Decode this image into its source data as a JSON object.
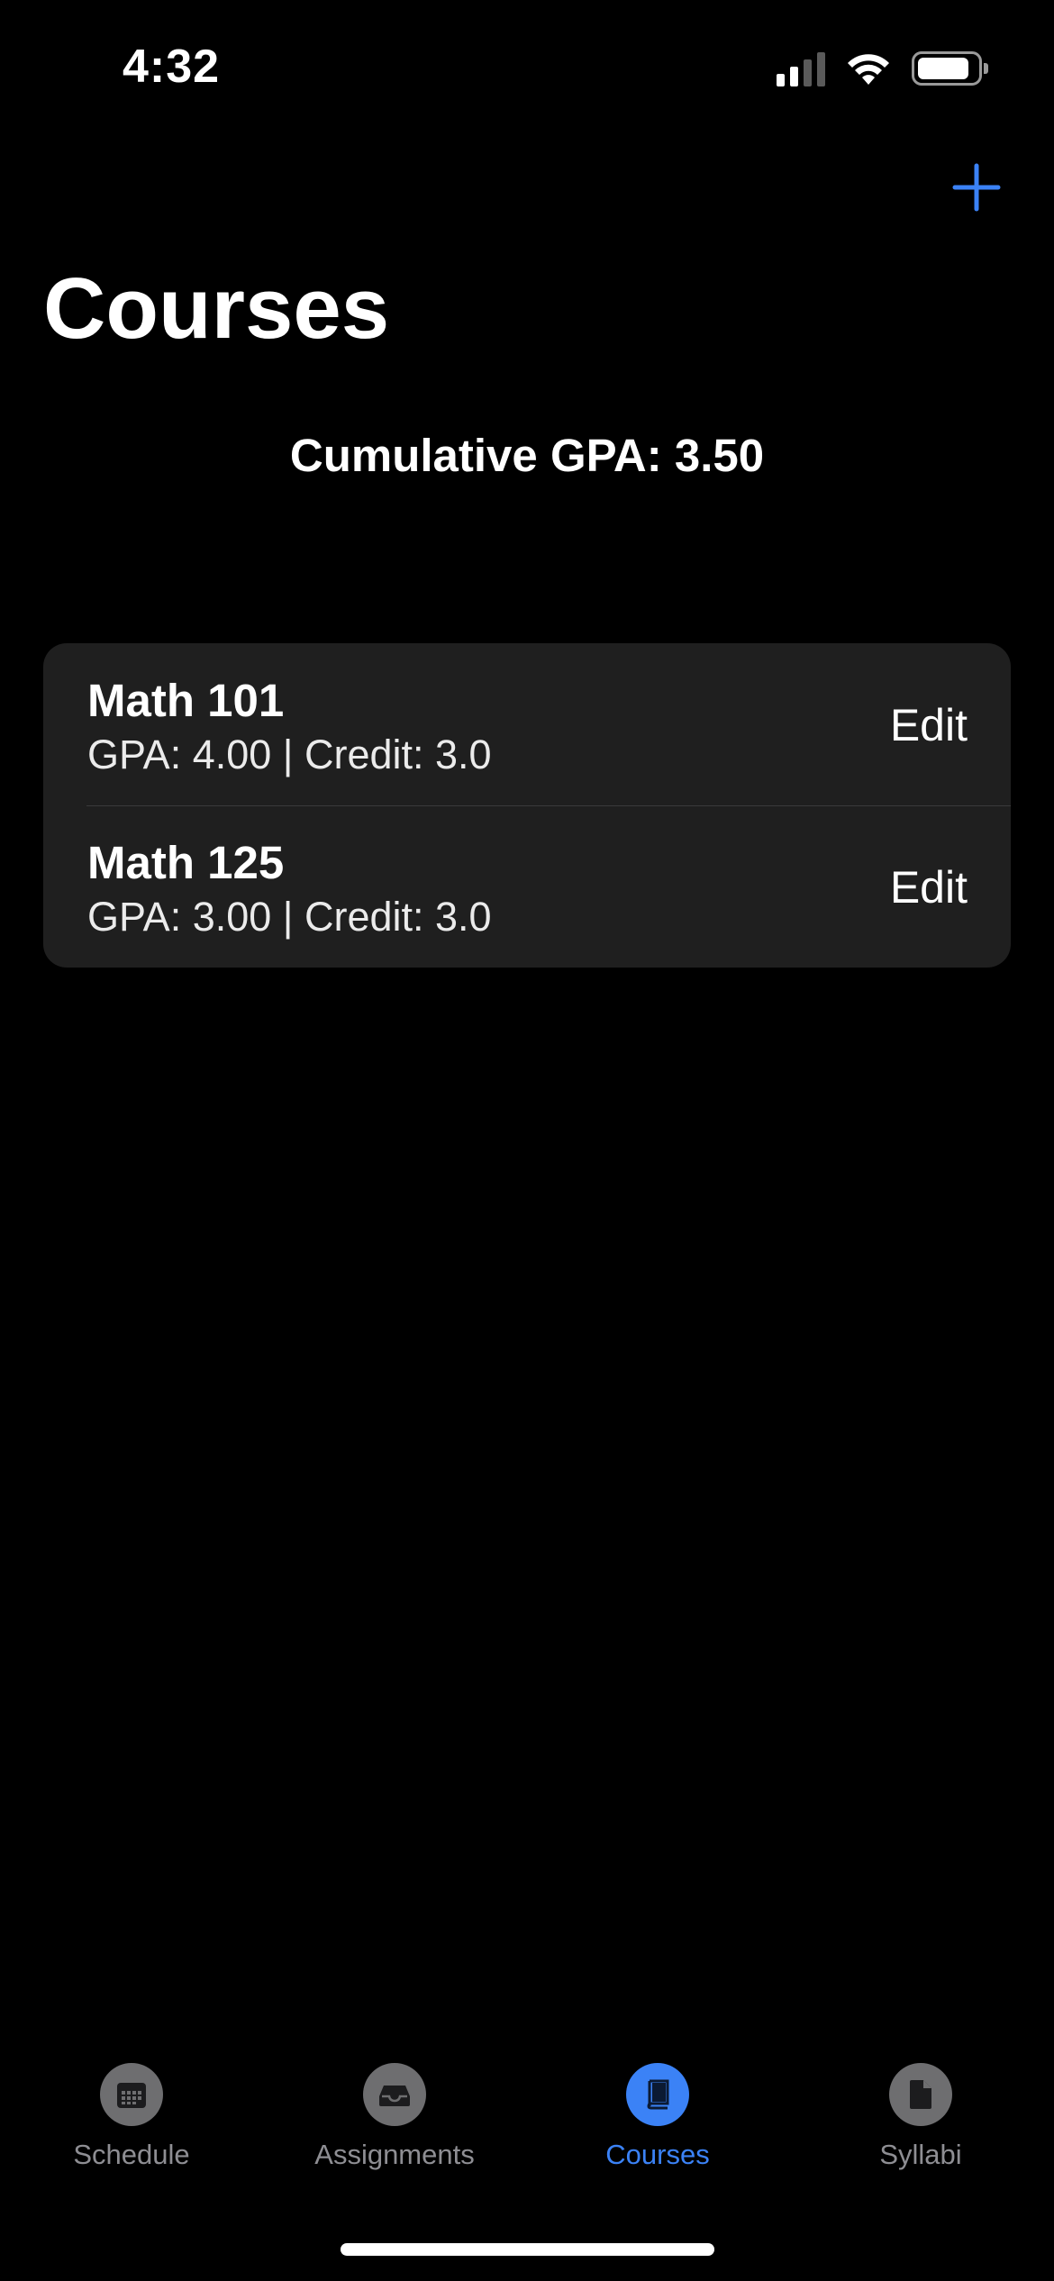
{
  "status_bar": {
    "time": "4:32",
    "icons": [
      "cellular-signal-icon",
      "wifi-icon",
      "battery-icon"
    ]
  },
  "nav": {
    "add_icon": "plus-icon",
    "title": "Courses"
  },
  "summary": {
    "cumulative_gpa": "Cumulative GPA: 3.50"
  },
  "courses": [
    {
      "name": "Math 101",
      "detail": "GPA: 4.00 | Credit: 3.0",
      "edit_label": "Edit"
    },
    {
      "name": "Math 125",
      "detail": "GPA: 3.00 | Credit: 3.0",
      "edit_label": "Edit"
    }
  ],
  "tabs": [
    {
      "label": "Schedule",
      "icon": "calendar-icon",
      "active": false
    },
    {
      "label": "Assignments",
      "icon": "tray-icon",
      "active": false
    },
    {
      "label": "Courses",
      "icon": "book-icon",
      "active": true
    },
    {
      "label": "Syllabi",
      "icon": "document-icon",
      "active": false
    }
  ],
  "colors": {
    "background": "#000000",
    "card": "#1f1f1f",
    "accent": "#3b82f6",
    "inactive": "#8e8e93"
  }
}
